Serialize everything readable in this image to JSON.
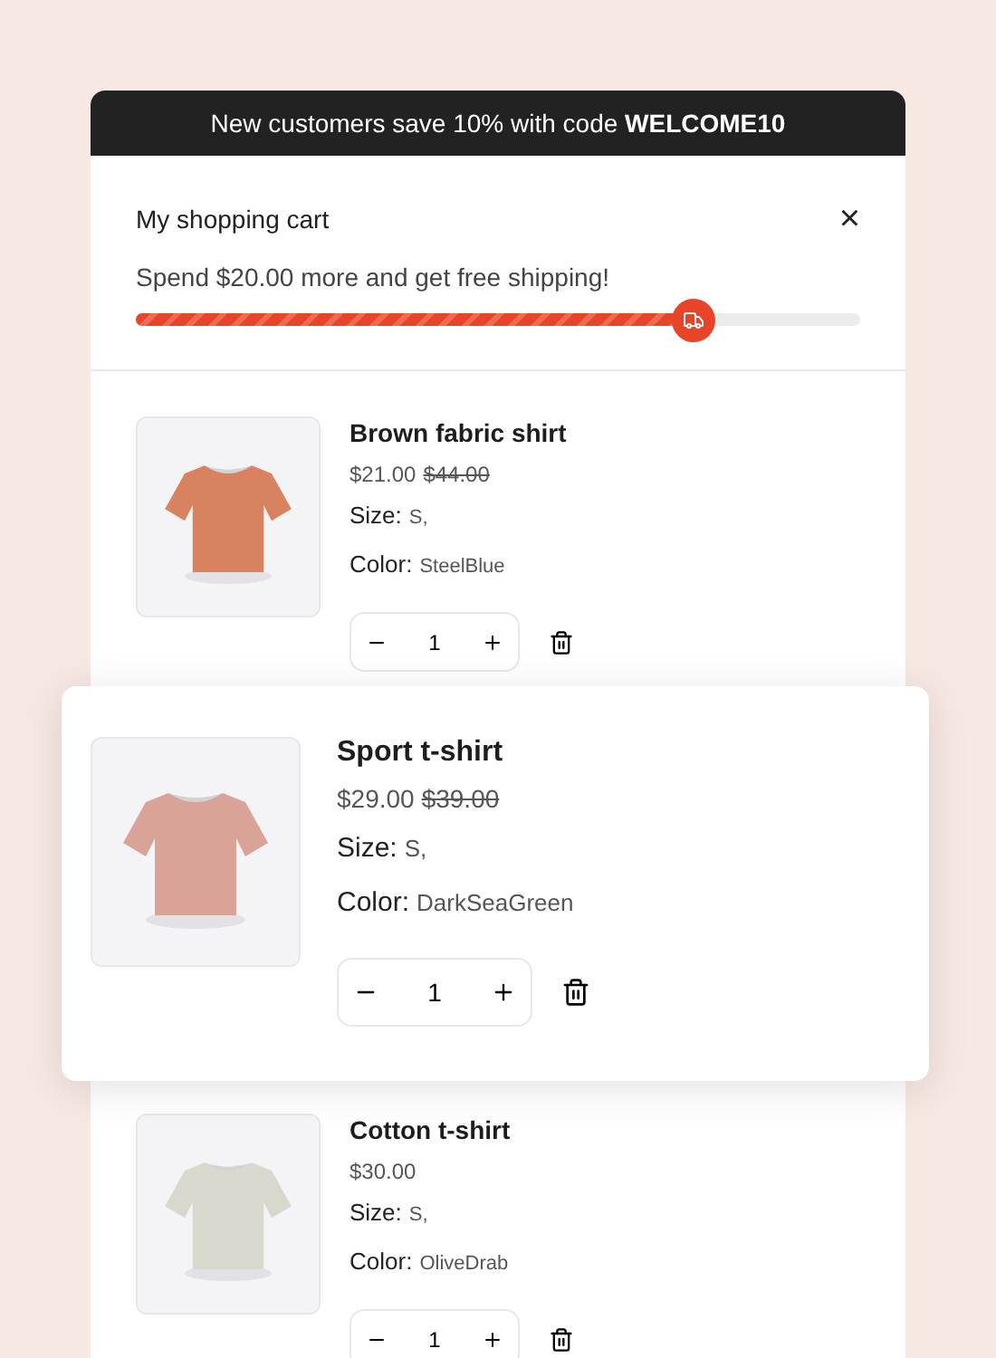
{
  "banner": {
    "text": "New customers save 10% with code **WELCOME10**"
  },
  "cart": {
    "title": "My shopping cart",
    "close": "×",
    "shipping_message": "Spend $20.00 more and get free shipping!",
    "shipping_progress": {
      "level": 0.77
    }
  },
  "items": [
    {
      "name": "Brown fabric shirt",
      "price": "$21.00",
      "old_price": "$44.00",
      "size_label": "Size:",
      "size": "S,",
      "color_label": "Color:",
      "color_name": "SteelBlue",
      "quantity": "1",
      "highlighted": false
    },
    {
      "name": "Sport t-shirt",
      "price": "$29.00",
      "old_price": "$39.00",
      "size_label": "Size:",
      "size": "S,",
      "color_label": "Color:",
      "color_name": "DarkSeaGreen",
      "quantity": "1",
      "highlighted": true
    },
    {
      "name": "Cotton t-shirt",
      "price": "$30.00",
      "size_label": "Size:",
      "size": "S,",
      "color_label": "Color:",
      "color_name": "OliveDrab",
      "quantity": "1",
      "highlighted": false
    }
  ]
}
